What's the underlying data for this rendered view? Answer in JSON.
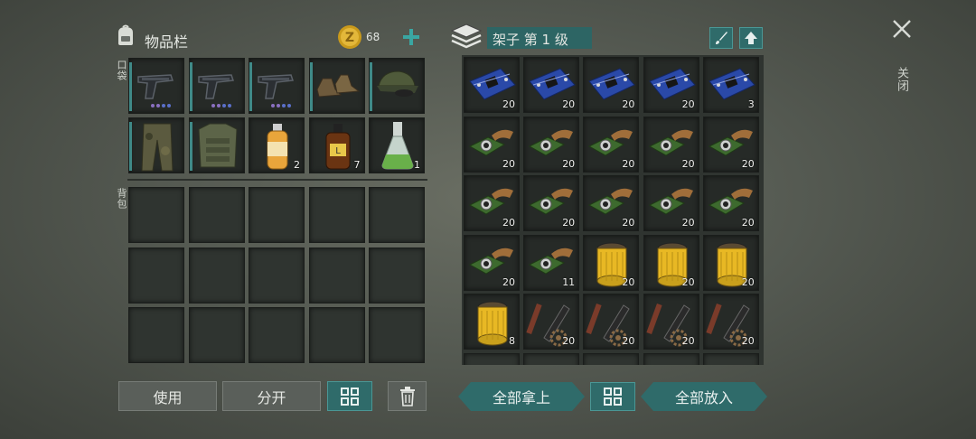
{
  "inventory": {
    "title": "物品栏",
    "coins": "68",
    "pocket_label": "口袋",
    "backpack_label": "背包",
    "pocket_items": [
      {
        "name": "pistol",
        "count": ""
      },
      {
        "name": "pistol",
        "count": ""
      },
      {
        "name": "pistol",
        "count": ""
      },
      {
        "name": "boots",
        "count": ""
      },
      {
        "name": "cap",
        "count": ""
      },
      {
        "name": "camo-pants",
        "count": ""
      },
      {
        "name": "body-armor",
        "count": ""
      },
      {
        "name": "orange-bottle",
        "count": "2"
      },
      {
        "name": "brown-bottle",
        "count": "7"
      },
      {
        "name": "flask",
        "count": "1"
      }
    ]
  },
  "shelf": {
    "title": "架子 第 1 级",
    "items": [
      {
        "name": "circuit-board",
        "count": "20"
      },
      {
        "name": "circuit-board",
        "count": "20"
      },
      {
        "name": "circuit-board",
        "count": "20"
      },
      {
        "name": "circuit-board",
        "count": "20"
      },
      {
        "name": "circuit-board",
        "count": "3"
      },
      {
        "name": "camera-module",
        "count": "20"
      },
      {
        "name": "camera-module",
        "count": "20"
      },
      {
        "name": "camera-module",
        "count": "20"
      },
      {
        "name": "camera-module",
        "count": "20"
      },
      {
        "name": "camera-module",
        "count": "20"
      },
      {
        "name": "camera-module",
        "count": "20"
      },
      {
        "name": "camera-module",
        "count": "20"
      },
      {
        "name": "camera-module",
        "count": "20"
      },
      {
        "name": "camera-module",
        "count": "20"
      },
      {
        "name": "camera-module",
        "count": "20"
      },
      {
        "name": "camera-module",
        "count": "20"
      },
      {
        "name": "camera-module",
        "count": "11"
      },
      {
        "name": "oil-filter",
        "count": "20"
      },
      {
        "name": "oil-filter",
        "count": "20"
      },
      {
        "name": "oil-filter",
        "count": "20"
      },
      {
        "name": "oil-filter",
        "count": "8"
      },
      {
        "name": "gear-parts",
        "count": "20"
      },
      {
        "name": "gear-parts",
        "count": "20"
      },
      {
        "name": "gear-parts",
        "count": "20"
      },
      {
        "name": "gear-parts",
        "count": "20"
      }
    ]
  },
  "buttons": {
    "use": "使用",
    "split": "分开",
    "take_all": "全部拿上",
    "put_all": "全部放入",
    "close": "关闭"
  }
}
